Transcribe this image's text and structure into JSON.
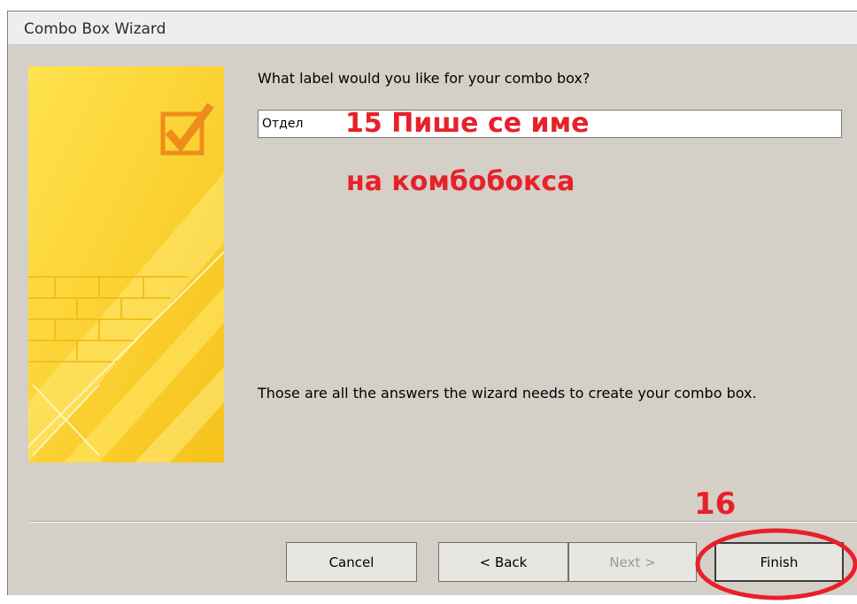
{
  "window": {
    "title": "Combo Box Wizard"
  },
  "content": {
    "question": "What label would you like for your combo box?",
    "label_value": "Отдел",
    "summary": "Those are all the answers the wizard needs to create your combo box."
  },
  "annotations": {
    "step15_line1": "15 Пише се име",
    "step15_line2": "на комбобокса",
    "step16": "16"
  },
  "buttons": {
    "cancel": "Cancel",
    "back": "< Back",
    "next": "Next >",
    "finish": "Finish"
  },
  "colors": {
    "annotation": "#e8202a",
    "dialog_background": "#d4d0c8",
    "banner_yellow": "#fdd835"
  },
  "icons": {
    "banner": "checkmark-box-icon"
  }
}
